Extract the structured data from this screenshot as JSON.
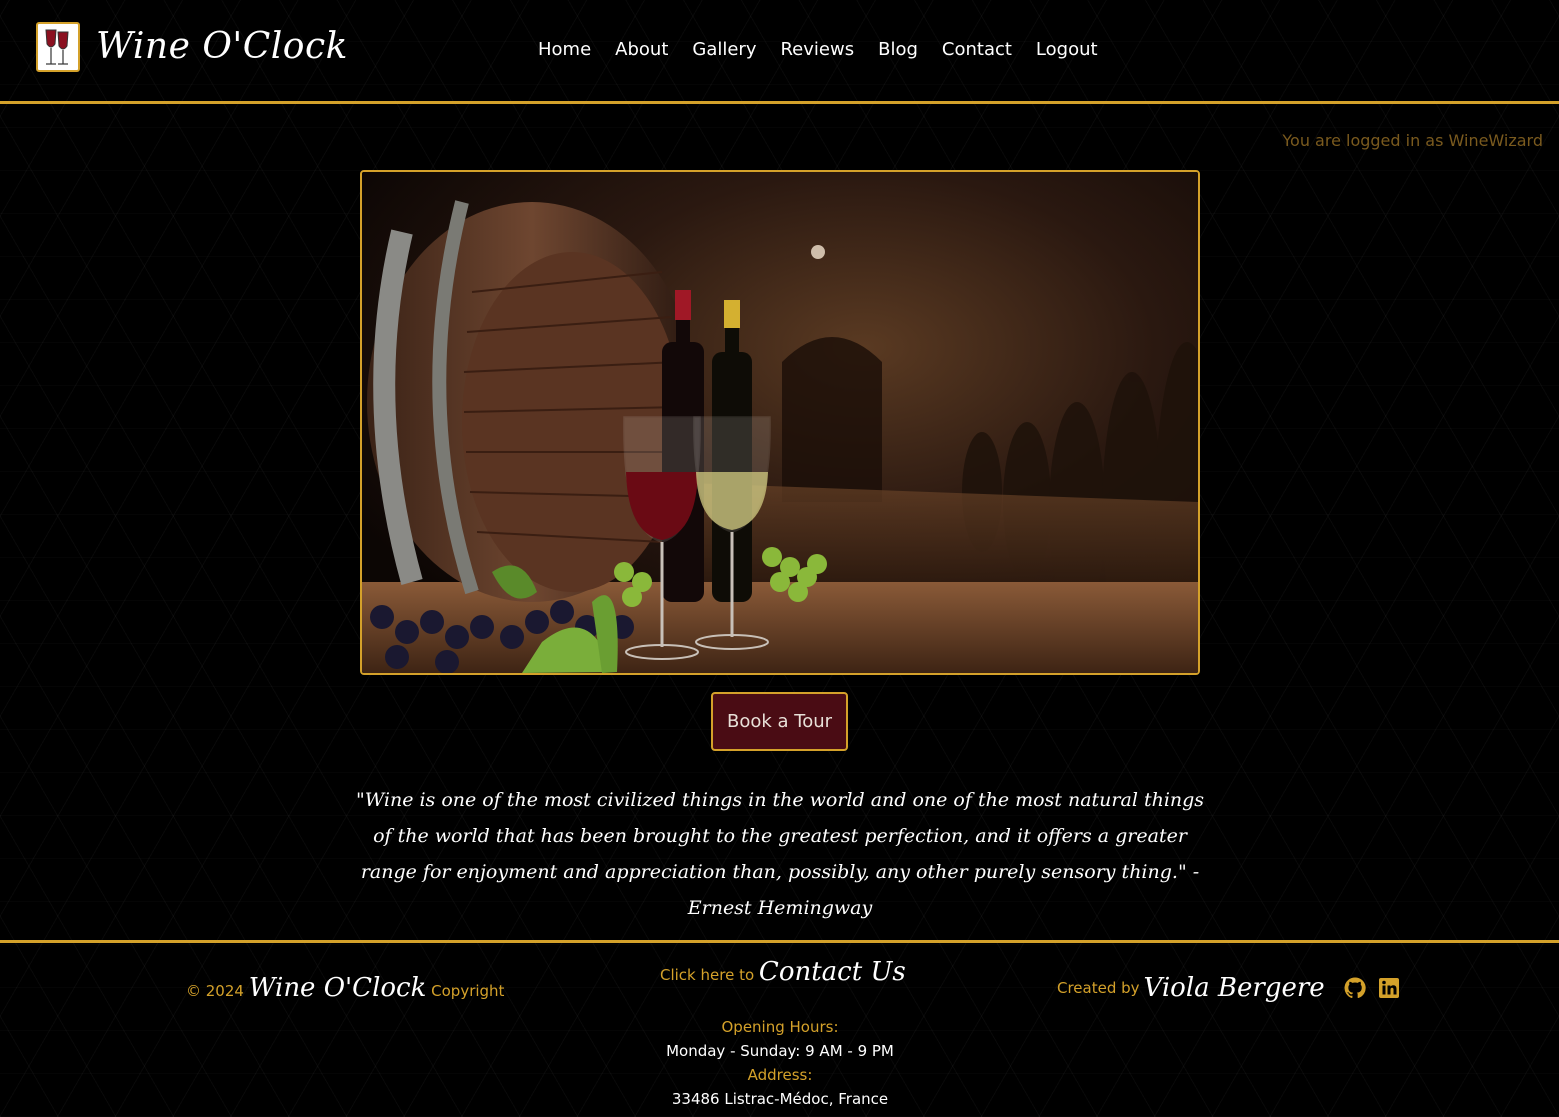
{
  "header": {
    "brand": "Wine O'Clock",
    "nav": [
      "Home",
      "About",
      "Gallery",
      "Reviews",
      "Blog",
      "Contact",
      "Logout"
    ]
  },
  "login_status": "You are logged in as WineWizard",
  "hero": {
    "book_button": "Book a Tour"
  },
  "quote": "\"Wine is one of the most civilized things in the world and one of the most natural things of the world that has been brought to the greatest perfection, and it offers a greater range for enjoyment and appreciation than, possibly, any other purely sensory thing.\" -Ernest Hemingway",
  "footer": {
    "copyright_prefix": "© 2024",
    "copyright_brand": "Wine O'Clock",
    "copyright_suffix": "Copyright",
    "contact_prefix": "Click here to",
    "contact_link": "Contact Us",
    "hours_label": "Opening Hours:",
    "hours_value": "Monday - Sunday: 9 AM - 9 PM",
    "address_label": "Address:",
    "address_value": "33486 Listrac-Médoc, France",
    "created_prefix": "Created by",
    "created_name": "Viola Bergere",
    "icons": [
      "github-icon",
      "linkedin-icon"
    ]
  },
  "colors": {
    "accent_gold": "#d4a12a",
    "button_wine": "#4a0c14",
    "background": "#000000"
  }
}
